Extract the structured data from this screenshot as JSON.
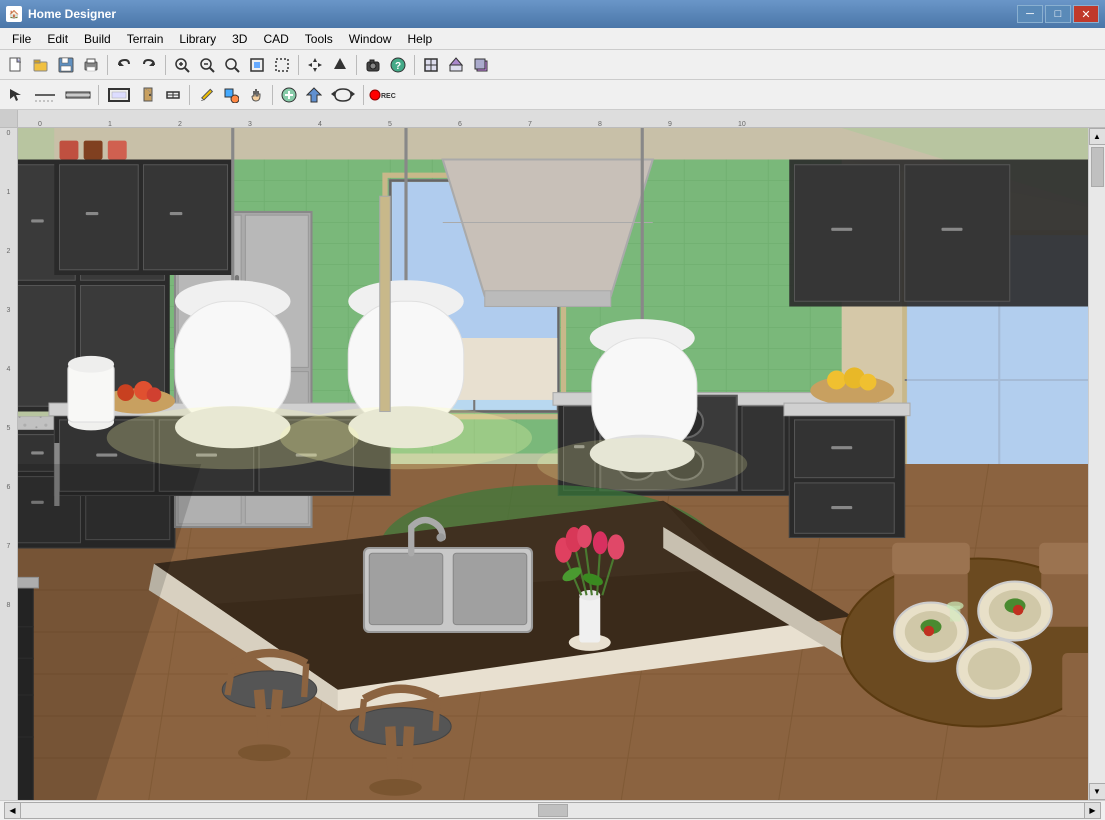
{
  "window": {
    "title": "Home Designer",
    "icon": "🏠"
  },
  "title_controls": {
    "minimize": "─",
    "maximize": "□",
    "close": "✕"
  },
  "menubar": {
    "items": [
      {
        "label": "File",
        "id": "menu-file"
      },
      {
        "label": "Edit",
        "id": "menu-edit"
      },
      {
        "label": "Build",
        "id": "menu-build"
      },
      {
        "label": "Terrain",
        "id": "menu-terrain"
      },
      {
        "label": "Library",
        "id": "menu-library"
      },
      {
        "label": "3D",
        "id": "menu-3d"
      },
      {
        "label": "CAD",
        "id": "menu-cad"
      },
      {
        "label": "Tools",
        "id": "menu-tools"
      },
      {
        "label": "Window",
        "id": "menu-window"
      },
      {
        "label": "Help",
        "id": "menu-help"
      }
    ]
  },
  "toolbar1": {
    "buttons": [
      {
        "icon": "📄",
        "label": "New",
        "id": "btn-new"
      },
      {
        "icon": "📂",
        "label": "Open",
        "id": "btn-open"
      },
      {
        "icon": "💾",
        "label": "Save",
        "id": "btn-save"
      },
      {
        "icon": "🖨",
        "label": "Print",
        "id": "btn-print"
      },
      {
        "icon": "↩",
        "label": "Undo",
        "id": "btn-undo"
      },
      {
        "icon": "↪",
        "label": "Redo",
        "id": "btn-redo"
      },
      {
        "icon": "🔍",
        "label": "Zoom Fit",
        "id": "btn-zoom-fit"
      },
      {
        "icon": "⊕",
        "label": "Zoom In",
        "id": "btn-zoom-in"
      },
      {
        "icon": "⊖",
        "label": "Zoom Out",
        "id": "btn-zoom-out"
      },
      {
        "icon": "⊡",
        "label": "Zoom All",
        "id": "btn-zoom-all"
      },
      {
        "icon": "⊞",
        "label": "Zoom Box",
        "id": "btn-zoom-box"
      },
      {
        "icon": "↕",
        "label": "Pan",
        "id": "btn-pan"
      },
      {
        "icon": "↕",
        "label": "Pan2",
        "id": "btn-pan2"
      },
      {
        "icon": "∧",
        "label": "Up",
        "id": "btn-up"
      },
      {
        "icon": "⬛",
        "label": "Cam",
        "id": "btn-cam"
      },
      {
        "icon": "?",
        "label": "Help",
        "id": "btn-help"
      },
      {
        "icon": "🏠",
        "label": "Floor Plan",
        "id": "btn-floorplan"
      },
      {
        "icon": "🏘",
        "label": "Elevation",
        "id": "btn-elevation"
      },
      {
        "icon": "🏠",
        "label": "3D View",
        "id": "btn-3dview"
      }
    ]
  },
  "toolbar2": {
    "buttons": [
      {
        "icon": "↖",
        "label": "Select",
        "id": "btn-select"
      },
      {
        "icon": "〰",
        "label": "Draw Line",
        "id": "btn-draw-line"
      },
      {
        "icon": "⊸",
        "label": "Wall",
        "id": "btn-wall"
      },
      {
        "icon": "▦",
        "label": "Room",
        "id": "btn-room"
      },
      {
        "icon": "🚪",
        "label": "Door",
        "id": "btn-door"
      },
      {
        "icon": "🪟",
        "label": "Window",
        "id": "btn-window"
      },
      {
        "icon": "✏",
        "label": "Stair",
        "id": "btn-stair"
      },
      {
        "icon": "∿",
        "label": "Roof",
        "id": "btn-roof"
      },
      {
        "icon": "✋",
        "label": "Hand",
        "id": "btn-hand"
      },
      {
        "icon": "⊕",
        "label": "Add",
        "id": "btn-add"
      },
      {
        "icon": "△",
        "label": "Arrow",
        "id": "btn-arrow"
      },
      {
        "icon": "⟲",
        "label": "Rotate",
        "id": "btn-rotate"
      },
      {
        "icon": "⏺",
        "label": "Record",
        "id": "btn-record"
      }
    ]
  },
  "rulers": {
    "top_marks": [
      "0",
      "1",
      "2",
      "3",
      "4",
      "5",
      "6",
      "7",
      "8",
      "9",
      "10"
    ],
    "left_marks": [
      "0",
      "1",
      "2",
      "3",
      "4",
      "5",
      "6",
      "7",
      "8"
    ]
  },
  "scrollbars": {
    "left_arrow": "▲",
    "right_arrow": "▼",
    "h_left_arrow": "◀",
    "h_right_arrow": "▶"
  },
  "scene": {
    "description": "3D kitchen interior view with island, cabinets, pendant lights"
  }
}
